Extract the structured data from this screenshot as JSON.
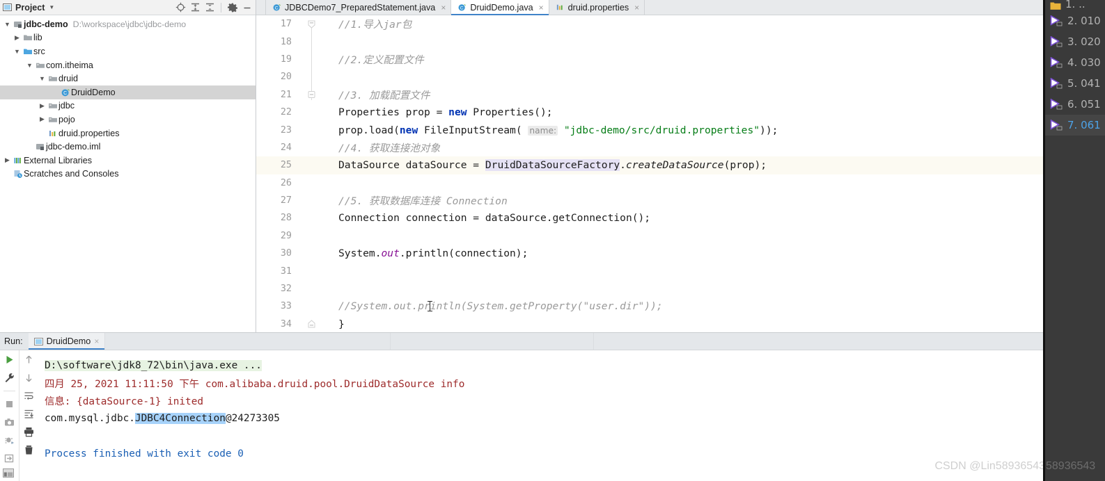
{
  "project_panel": {
    "title": "Project",
    "icons": [
      "project-icon",
      "chevron-down-icon",
      "locate-icon",
      "expand-all-icon",
      "collapse-all-icon",
      "gear-icon",
      "minimize-icon"
    ],
    "tree": [
      {
        "label": "jdbc-demo",
        "path": "D:\\workspace\\jdbc\\jdbc-demo",
        "icon": "module-icon",
        "arrow": "expanded",
        "indent": 0,
        "bold": true,
        "selected": false
      },
      {
        "label": "lib",
        "path": "",
        "icon": "folder-icon",
        "arrow": "collapsed",
        "indent": 1,
        "bold": false,
        "selected": false
      },
      {
        "label": "src",
        "path": "",
        "icon": "source-folder-icon",
        "arrow": "expanded",
        "indent": 1,
        "bold": false,
        "selected": false
      },
      {
        "label": "com.itheima",
        "path": "",
        "icon": "package-icon",
        "arrow": "expanded",
        "indent": 2,
        "bold": false,
        "selected": false
      },
      {
        "label": "druid",
        "path": "",
        "icon": "package-icon",
        "arrow": "expanded",
        "indent": 3,
        "bold": false,
        "selected": false
      },
      {
        "label": "DruidDemo",
        "path": "",
        "icon": "java-class-icon",
        "arrow": "none",
        "indent": 4,
        "bold": false,
        "selected": true
      },
      {
        "label": "jdbc",
        "path": "",
        "icon": "package-icon",
        "arrow": "collapsed",
        "indent": 3,
        "bold": false,
        "selected": false
      },
      {
        "label": "pojo",
        "path": "",
        "icon": "package-icon",
        "arrow": "collapsed",
        "indent": 3,
        "bold": false,
        "selected": false
      },
      {
        "label": "druid.properties",
        "path": "",
        "icon": "properties-icon",
        "arrow": "none",
        "indent": 3,
        "bold": false,
        "selected": false
      },
      {
        "label": "jdbc-demo.iml",
        "path": "",
        "icon": "module-icon",
        "arrow": "none",
        "indent": 2,
        "bold": false,
        "selected": false
      },
      {
        "label": "External Libraries",
        "path": "",
        "icon": "libraries-icon",
        "arrow": "collapsed",
        "indent": 0,
        "bold": false,
        "selected": false
      },
      {
        "label": "Scratches and Consoles",
        "path": "",
        "icon": "scratches-icon",
        "arrow": "none",
        "indent": 0,
        "bold": false,
        "selected": false
      }
    ]
  },
  "editor": {
    "tabs": [
      {
        "label": "JDBCDemo7_PreparedStatement.java",
        "icon": "java-class-icon",
        "active": false
      },
      {
        "label": "DruidDemo.java",
        "icon": "java-class-icon",
        "active": true
      },
      {
        "label": "druid.properties",
        "icon": "properties-icon",
        "active": false
      }
    ],
    "close_glyph": "×",
    "inspection_status": "no-errors-check",
    "lines": [
      {
        "num": "17",
        "fold": "start"
      },
      {
        "num": "18",
        "fold": "none"
      },
      {
        "num": "19",
        "fold": "none"
      },
      {
        "num": "20",
        "fold": "none"
      },
      {
        "num": "21",
        "fold": "start"
      },
      {
        "num": "22",
        "fold": "none"
      },
      {
        "num": "23",
        "fold": "none"
      },
      {
        "num": "24",
        "fold": "none"
      },
      {
        "num": "25",
        "fold": "none"
      },
      {
        "num": "26",
        "fold": "none"
      },
      {
        "num": "27",
        "fold": "none"
      },
      {
        "num": "28",
        "fold": "none"
      },
      {
        "num": "29",
        "fold": "none"
      },
      {
        "num": "30",
        "fold": "none"
      },
      {
        "num": "31",
        "fold": "none"
      },
      {
        "num": "32",
        "fold": "none"
      },
      {
        "num": "33",
        "fold": "none"
      },
      {
        "num": "34",
        "fold": "end"
      }
    ],
    "code": {
      "l17": "//1.导入jar包",
      "l19": "//2.定义配置文件",
      "l21": "//3. 加载配置文件",
      "l22_a": "Properties prop = ",
      "l22_kw": "new",
      "l22_b": " Properties();",
      "l23_a": "prop.load(",
      "l23_kw": "new",
      "l23_b": " FileInputStream( ",
      "l23_hint": "name:",
      "l23_str": "\"jdbc-demo/src/druid.properties\"",
      "l23_c": "));",
      "l24": "//4. 获取连接池对象",
      "l25_a": "DataSource dataSource = ",
      "l25_hl": "DruidDataSourceFactory",
      "l25_dot": ".",
      "l25_m": "createDataSource",
      "l25_b": "(prop);",
      "l27": "//5. 获取数据库连接 Connection",
      "l28": "Connection connection = dataSource.getConnection();",
      "l30_a": "System.",
      "l30_static": "out",
      "l30_b": ".println(connection);",
      "l33": "//System.out.println(System.getProperty(\"user.dir\"));",
      "l34": "}"
    }
  },
  "run_panel": {
    "label": "Run:",
    "tab_label": "DruidDemo",
    "tab_icon": "run-config-icon",
    "close_glyph": "×",
    "header_icons": [
      "gear-icon",
      "minimize-icon"
    ],
    "toolbar_primary": [
      "rerun-icon",
      "wrench-icon",
      "stop-icon",
      "camera-icon",
      "debug-rerun-icon",
      "export-icon"
    ],
    "toolbar_secondary": [
      "arrow-up-icon",
      "arrow-down-icon",
      "soft-wrap-icon",
      "scroll-to-end-icon",
      "print-icon",
      "trash-icon"
    ],
    "console": {
      "command": "D:\\software\\jdk8_72\\bin\\java.exe ...",
      "log_line_1": "四月 25, 2021 11:11:50 下午 com.alibaba.druid.pool.DruidDataSource info",
      "log_line_2": "信息: {dataSource-1} inited",
      "output_prefix": "com.mysql.jdbc.",
      "output_selected": "JDBC4Connection",
      "output_suffix": "@24273305",
      "finished": "Process finished with exit code 0"
    }
  },
  "overlay": {
    "items": [
      {
        "label": "1. ..",
        "icon": "folder-icon",
        "active": false
      },
      {
        "label": "2. 010",
        "icon": "video-play-icon",
        "active": false
      },
      {
        "label": "3. 020",
        "icon": "video-play-icon",
        "active": false
      },
      {
        "label": "4. 030",
        "icon": "video-play-icon",
        "active": false
      },
      {
        "label": "5. 041",
        "icon": "video-play-icon",
        "active": false
      },
      {
        "label": "6. 051",
        "icon": "video-play-icon",
        "active": false
      },
      {
        "label": "7. 061",
        "icon": "video-play-icon",
        "active": true
      }
    ]
  },
  "watermark": {
    "text": "CSDN @Lin58936543",
    "clipped": "58936543"
  },
  "status_bar": {
    "icon": "layout-icon"
  }
}
